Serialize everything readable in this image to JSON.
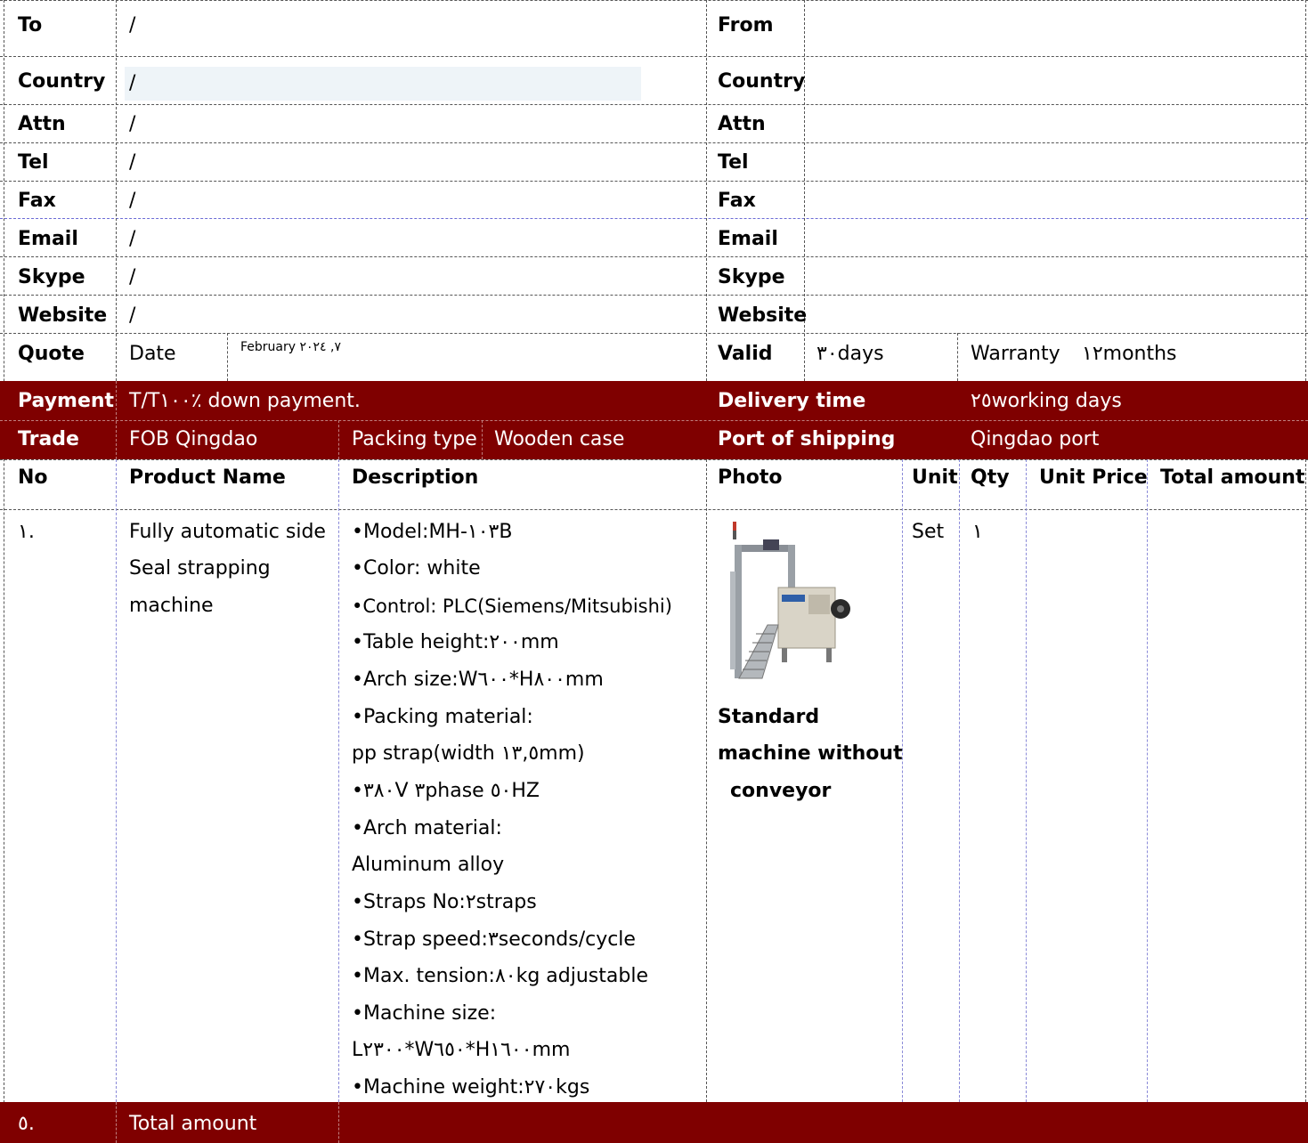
{
  "header": {
    "to_label": "To",
    "to_value": "/",
    "from_label": "From",
    "country_label": "Country",
    "country_value": "/",
    "from_country_label": "Country",
    "attn_label": "Attn",
    "attn_value": "/",
    "from_attn_label": "Attn",
    "tel_label": "Tel",
    "tel_value": "/",
    "from_tel_label": "Tel",
    "fax_label": "Fax",
    "fax_value": "/",
    "from_fax_label": "Fax",
    "email_label": "Email",
    "email_value": "/",
    "from_email_label": "Email",
    "skype_label": "Skype",
    "skype_value": "/",
    "from_skype_label": "Skype",
    "website_label": "Website",
    "website_value": "/",
    "from_website_label": "Website"
  },
  "quote": {
    "label": "Quote",
    "date_label": "Date",
    "date_value": "February ٧, ٢٠٢٤",
    "valid_label": "Valid",
    "valid_value": "٣٠days",
    "warranty_label": "Warranty",
    "warranty_value": "١٢months"
  },
  "terms": {
    "payment_label": "Payment",
    "payment_value": "T/T١٠٠٪ down payment.",
    "delivery_label": "Delivery time",
    "delivery_value": "٢٥working days",
    "trade_label": "Trade",
    "trade_value": "FOB Qingdao",
    "packing_label": "Packing type",
    "packing_value": "Wooden case",
    "port_label": "Port of shipping",
    "port_value": "Qingdao port"
  },
  "table": {
    "columns": [
      "No",
      "Product Name",
      "Description",
      "Photo",
      "Unit",
      "Qty",
      "Unit Price",
      "Total amount"
    ],
    "row": {
      "no": "١.",
      "name_lines": [
        "Fully automatic side",
        "Seal strapping",
        "machine"
      ],
      "description_lines": [
        "•Model:MH-١٠٣B",
        "•Color: white",
        "•Control: PLC(Siemens/Mitsubishi)",
        "•Table height:٢٠٠mm",
        "•Arch size:W٦٠٠*H٨٠٠mm",
        "•Packing material:",
        "pp strap(width ١٣,٥mm)",
        "•٣٨٠V ٣phase ٥٠HZ",
        "•Arch material:",
        "Aluminum alloy",
        "•Straps No:٢straps",
        "•Strap speed:٣seconds/cycle",
        "•Max. tension:٨٠kg adjustable",
        "•Machine size:",
        "L٢٣٠٠*W٦٥٠*H١٦٠٠mm",
        "•Machine weight:٢٧٠kgs"
      ],
      "photo_caption_lines": [
        "Standard",
        "machine without",
        "conveyor"
      ],
      "unit": "Set",
      "qty": "١"
    },
    "total_no": "٥.",
    "total_label": "Total amount"
  },
  "colors": {
    "band": "#7f0000",
    "band_text": "#ffffff",
    "highlight": "#eef4f8"
  }
}
